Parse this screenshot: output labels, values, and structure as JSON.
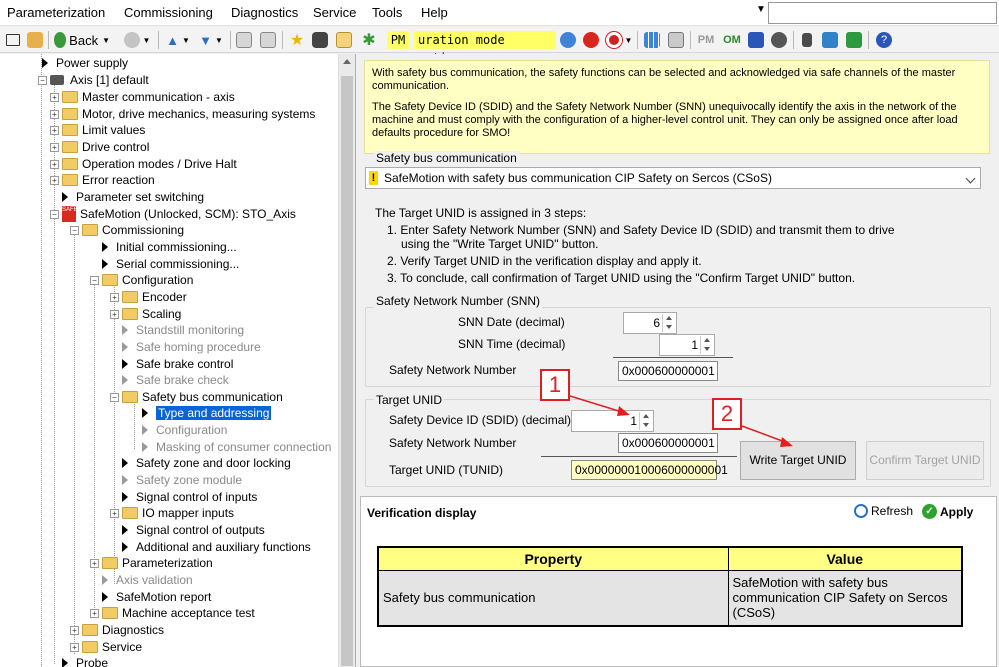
{
  "menu": {
    "items": [
      "Parameterization",
      "Commissioning",
      "Diagnostics",
      "Service",
      "Tools",
      "Help"
    ]
  },
  "toolbar": {
    "back_label": "Back",
    "pm_label": "PM",
    "mode_text": "uration mode active",
    "pm2_label": "PM",
    "om_label": "OM"
  },
  "tree": {
    "items": [
      {
        "label": "Power supply"
      },
      {
        "label": "Axis [1] default"
      },
      {
        "label": "Master communication - axis"
      },
      {
        "label": "Motor, drive mechanics, measuring systems"
      },
      {
        "label": "Limit values"
      },
      {
        "label": "Drive control"
      },
      {
        "label": "Operation modes / Drive Halt"
      },
      {
        "label": "Error reaction"
      },
      {
        "label": "Parameter set switching"
      },
      {
        "label": "SafeMotion (Unlocked, SCM): STO_Axis"
      },
      {
        "label": "Commissioning"
      },
      {
        "label": "Initial commissioning..."
      },
      {
        "label": "Serial commissioning..."
      },
      {
        "label": "Configuration"
      },
      {
        "label": "Encoder"
      },
      {
        "label": "Scaling"
      },
      {
        "label": "Standstill monitoring"
      },
      {
        "label": "Safe homing procedure"
      },
      {
        "label": "Safe brake control"
      },
      {
        "label": "Safe brake check"
      },
      {
        "label": "Safety bus communication"
      },
      {
        "label": "Type and addressing"
      },
      {
        "label": "Configuration"
      },
      {
        "label": "Masking of consumer connection"
      },
      {
        "label": "Safety zone and door locking"
      },
      {
        "label": "Safety zone module"
      },
      {
        "label": "Signal control of inputs"
      },
      {
        "label": "IO mapper inputs"
      },
      {
        "label": "Signal control of outputs"
      },
      {
        "label": "Additional and auxiliary functions"
      },
      {
        "label": "Parameterization"
      },
      {
        "label": "Axis validation"
      },
      {
        "label": "SafeMotion report"
      },
      {
        "label": "Machine acceptance test"
      },
      {
        "label": "Diagnostics"
      },
      {
        "label": "Service"
      },
      {
        "label": "Probe"
      }
    ],
    "safety_badge": "SAFE SCM"
  },
  "info": {
    "p1": "With safety bus communication, the safety functions can be selected and acknowledged via safe channels of the master communication.",
    "p2": "The Safety Device ID (SDID) and the Safety Network Number (SNN) unequivocally identify the axis in the network of the machine and must comply with the configuration of a higher-level control unit. They can only be assigned once after load defaults procedure for SMO!"
  },
  "bus": {
    "group_label": "Safety bus communication",
    "selected": "SafeMotion with safety bus communication CIP Safety on Sercos (CSoS)",
    "warn": "!"
  },
  "steps": {
    "intro": "The Target UNID is assigned in 3 steps:",
    "s1": "1.  Enter Safety Network Number (SNN) and Safety Device ID (SDID) and transmit them to drive using the \"Write Target UNID\" button.",
    "s2": "2.  Verify Target UNID in the verification display and apply it.",
    "s3": "3.  To conclude, call confirmation of Target UNID using the \"Confirm Target UNID\" button."
  },
  "snn": {
    "group_label": "Safety Network Number (SNN)",
    "date_label": "SNN Date (decimal)",
    "date_value": "6",
    "time_label": "SNN Time (decimal)",
    "time_value": "1",
    "net_label": "Safety Network Number",
    "net_value": "0x000600000001"
  },
  "target": {
    "group_label": "Target UNID",
    "sdid_label": "Safety Device ID (SDID) (decimal)",
    "sdid_value": "1",
    "net_label": "Safety Network Number",
    "net_value": "0x000600000001",
    "tunid_label": "Target UNID (TUNID)",
    "tunid_value": "0x000000010006000000001"
  },
  "buttons": {
    "write": "Write Target UNID",
    "confirm": "Confirm Target UNID"
  },
  "callouts": {
    "one": "1",
    "two": "2"
  },
  "verification": {
    "title": "Verification display",
    "refresh": "Refresh",
    "apply": "Apply",
    "headers": [
      "Property",
      "Value"
    ],
    "rows": [
      {
        "property": "Safety bus communication",
        "value": "SafeMotion with safety bus communication CIP Safety on Sercos (CSoS)"
      }
    ]
  },
  "colors": {
    "info_bg": "#ffffc4",
    "table_header": "#ffff84",
    "callout": "#e02020",
    "selection": "#0a64d6"
  }
}
